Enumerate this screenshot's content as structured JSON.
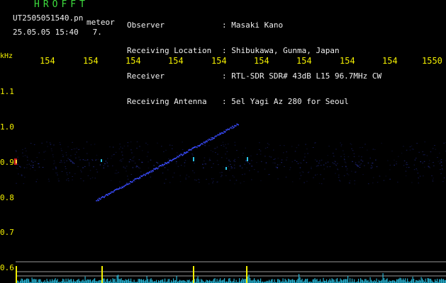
{
  "header": {
    "app_title": "HROFFT",
    "filename": "UT2505051540.pn",
    "mode": "meteor",
    "timestamp": "25.05.05 15:40",
    "timestamp_suffix": "7.",
    "info_keys": [
      "Observer",
      "Receiving Location",
      "Receiver",
      "Receiving Antenna"
    ],
    "info_values": [
      ": Masaki Kano",
      ": Shibukawa, Gunma, Japan",
      ": RTL-SDR SDR# 43dB L15 96.7MHz CW",
      ": 5el Yagi Az 280 for Seoul"
    ]
  },
  "plot": {
    "y_unit": "kHz",
    "x_ticks": [
      "154",
      "154",
      "154",
      "154",
      "154",
      "154",
      "154",
      "154",
      "154",
      "1550"
    ],
    "y_ticks": [
      "1.1",
      "1.0",
      "0.9",
      "0.8",
      "0.7",
      "0.6"
    ],
    "colors": {
      "background": "#000000",
      "header_green": "#3ddc3d",
      "tick_yellow": "#f4f000",
      "echo_blue": "#3a4cff",
      "noise_cyan": "#29c3e6",
      "trigger_yellow": "#f4f000"
    }
  }
}
